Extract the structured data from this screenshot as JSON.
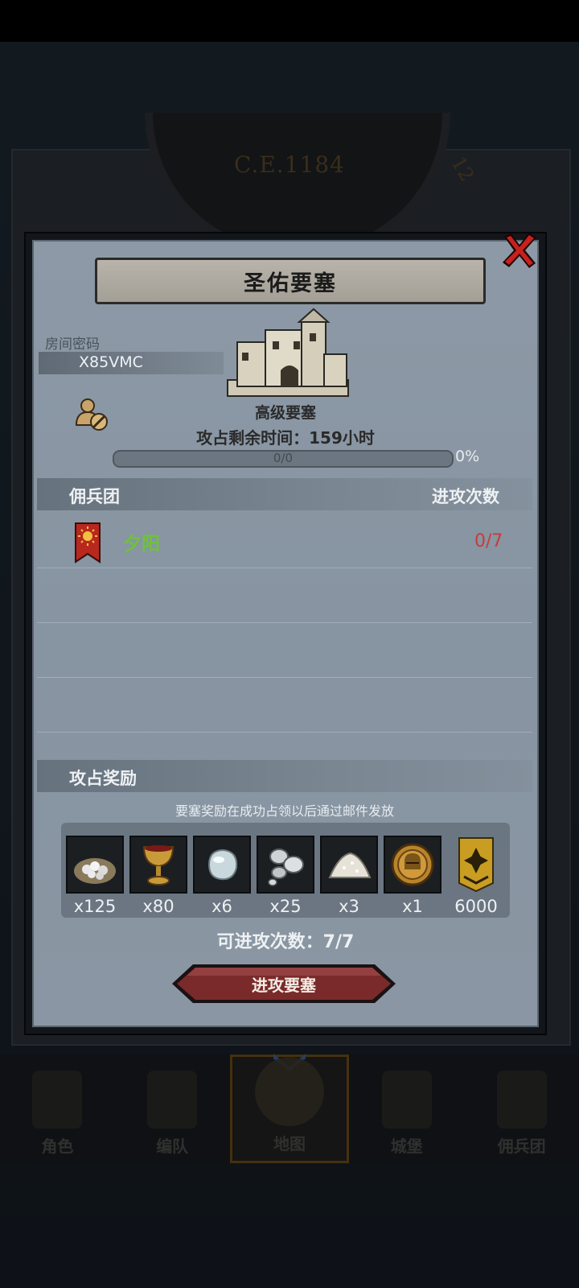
{
  "background": {
    "era": "C.E.1184",
    "dial_number": "12"
  },
  "modal": {
    "title": "圣佑要塞",
    "room_label": "房间密码",
    "room_code": "X85VMC",
    "fortress_type": "高级要塞",
    "time_left": "攻占剩余时间：159小时",
    "progress_text": "0/0",
    "progress_percent": "0%",
    "progress_value": 0,
    "mercenary_header": "佣兵团",
    "attacks_header": "进攻次数",
    "guilds": [
      {
        "name": "夕阳",
        "attacks": "0/7"
      }
    ],
    "reward_header": "攻占奖励",
    "reward_note": "要塞奖励在成功占领以后通过邮件发放",
    "rewards": [
      {
        "icon": "silver-ore-sack-icon",
        "qty": "x125"
      },
      {
        "icon": "golden-goblet-icon",
        "qty": "x80"
      },
      {
        "icon": "moonstone-icon",
        "qty": "x6"
      },
      {
        "icon": "silver-ingots-icon",
        "qty": "x25"
      },
      {
        "icon": "salt-pile-icon",
        "qty": "x3"
      },
      {
        "icon": "knight-helmet-medal-icon",
        "qty": "x1"
      },
      {
        "icon": "rank-emblem-icon",
        "qty": "6000"
      }
    ],
    "attack_count": "可进攻次数：7/7",
    "attack_button": "进攻要塞"
  },
  "nav": {
    "items": [
      "角色",
      "编队",
      "地图",
      "城堡",
      "佣兵团"
    ],
    "active": "地图"
  },
  "colors": {
    "guild_name": "#6fc13b",
    "attacks_red": "#c63c3c",
    "button_red": "#7a2a2a"
  }
}
